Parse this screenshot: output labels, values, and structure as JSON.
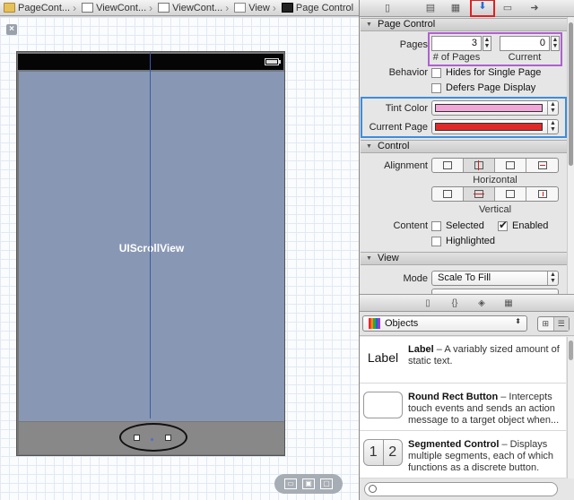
{
  "jumpbar": {
    "crumbs": [
      "PageCont...",
      "ViewCont...",
      "ViewCont...",
      "View",
      "Page Control"
    ]
  },
  "canvas": {
    "scroll_label": "UIScrollView",
    "page_dots": 2
  },
  "inspector": {
    "section_page_control": "Page Control",
    "pages_label": "Pages",
    "pages_value": "3",
    "pages_sub": "# of Pages",
    "current_value": "0",
    "current_sub": "Current",
    "behavior_label": "Behavior",
    "hides_single": "Hides for Single Page",
    "defers_display": "Defers Page Display",
    "tint_label": "Tint Color",
    "tint_color": "#f2a6d8",
    "current_page_label": "Current Page",
    "current_page_color": "#e02a2a",
    "section_control": "Control",
    "alignment_label": "Alignment",
    "horizontal": "Horizontal",
    "vertical": "Vertical",
    "content_label": "Content",
    "selected": "Selected",
    "enabled": "Enabled",
    "highlighted": "Highlighted",
    "section_view": "View",
    "mode_label": "Mode",
    "mode_value": "Scale To Fill"
  },
  "library": {
    "group": "Objects",
    "items": [
      {
        "thumb": "Label",
        "title": "Label",
        "desc": " – A variably sized amount of static text."
      },
      {
        "thumb": "",
        "title": "Round Rect Button",
        "desc": " – Intercepts touch events and sends an action message to a target object when..."
      },
      {
        "thumb_a": "1",
        "thumb_b": "2",
        "title": "Segmented Control",
        "desc": " – Displays multiple segments, each of which functions as a discrete button."
      }
    ]
  },
  "colors": {
    "canvas_view": "#8898b4",
    "highlight_purple": "#b060d0",
    "highlight_blue": "#3b8de0",
    "highlight_red": "#e02020"
  }
}
